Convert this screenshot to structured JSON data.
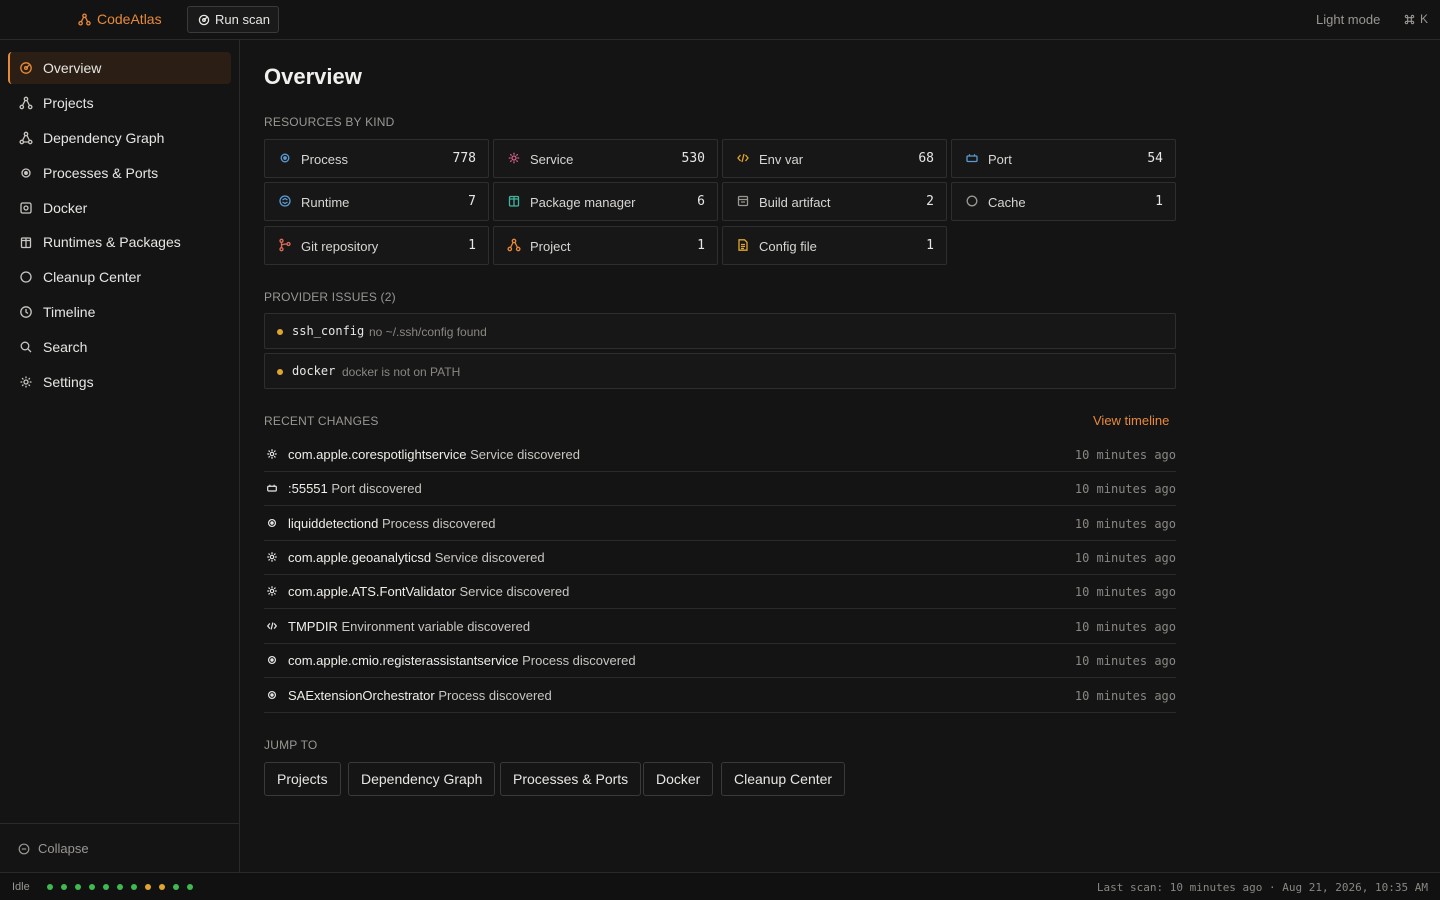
{
  "app": {
    "name": "CodeAtlas",
    "run_scan_label": "Run scan",
    "theme_toggle_label": "Light mode",
    "cmdk_key": "K"
  },
  "sidebar": {
    "items": [
      {
        "label": "Overview",
        "icon": "radar-icon",
        "active": true
      },
      {
        "label": "Projects",
        "icon": "project-icon"
      },
      {
        "label": "Dependency Graph",
        "icon": "graph-icon"
      },
      {
        "label": "Processes & Ports",
        "icon": "process-icon"
      },
      {
        "label": "Docker",
        "icon": "docker-icon"
      },
      {
        "label": "Runtimes & Packages",
        "icon": "package-icon"
      },
      {
        "label": "Cleanup Center",
        "icon": "cleanup-icon"
      },
      {
        "label": "Timeline",
        "icon": "clock-icon"
      },
      {
        "label": "Search",
        "icon": "search-icon"
      },
      {
        "label": "Settings",
        "icon": "gear-icon"
      }
    ],
    "collapse_label": "Collapse"
  },
  "main": {
    "title": "Overview",
    "resources_label": "RESOURCES BY KIND",
    "kinds": [
      {
        "label": "Process",
        "count": "778",
        "icon": "process-icon",
        "color": "#5b9bd5"
      },
      {
        "label": "Service",
        "count": "530",
        "icon": "service-icon",
        "color": "#d9608c"
      },
      {
        "label": "Env var",
        "count": "68",
        "icon": "env-var-icon",
        "color": "#e0a52e"
      },
      {
        "label": "Port",
        "count": "54",
        "icon": "port-icon",
        "color": "#5b9bd5"
      },
      {
        "label": "Runtime",
        "count": "7",
        "icon": "runtime-icon",
        "color": "#5b9bd5"
      },
      {
        "label": "Package manager",
        "count": "6",
        "icon": "package-manager-icon",
        "color": "#3fb5a0"
      },
      {
        "label": "Build artifact",
        "count": "2",
        "icon": "build-artifact-icon",
        "color": "#9a9792"
      },
      {
        "label": "Cache",
        "count": "1",
        "icon": "cache-icon",
        "color": "#9a9792"
      },
      {
        "label": "Git repository",
        "count": "1",
        "icon": "git-icon",
        "color": "#e06a5a"
      },
      {
        "label": "Project",
        "count": "1",
        "icon": "project-icon",
        "color": "#e8893a"
      },
      {
        "label": "Config file",
        "count": "1",
        "icon": "config-file-icon",
        "color": "#e0a52e"
      }
    ],
    "issues_label": "PROVIDER ISSUES (2)",
    "issues": [
      {
        "name": "ssh_config",
        "message": "no ~/.ssh/config found"
      },
      {
        "name": "docker",
        "message": "docker is not on PATH"
      }
    ],
    "changes_label": "RECENT CHANGES",
    "view_timeline_label": "View timeline",
    "changes": [
      {
        "name": "com.apple.corespotlightservice",
        "action": "Service discovered",
        "time": "10 minutes ago",
        "icon": "service-icon"
      },
      {
        "name": ":55551",
        "action": "Port discovered",
        "time": "10 minutes ago",
        "icon": "port-icon"
      },
      {
        "name": "liquiddetectiond",
        "action": "Process discovered",
        "time": "10 minutes ago",
        "icon": "process-icon"
      },
      {
        "name": "com.apple.geoanalyticsd",
        "action": "Service discovered",
        "time": "10 minutes ago",
        "icon": "service-icon"
      },
      {
        "name": "com.apple.ATS.FontValidator",
        "action": "Service discovered",
        "time": "10 minutes ago",
        "icon": "service-icon"
      },
      {
        "name": "TMPDIR",
        "action": "Environment variable discovered",
        "time": "10 minutes ago",
        "icon": "env-var-icon"
      },
      {
        "name": "com.apple.cmio.registerassistantservice",
        "action": "Process discovered",
        "time": "10 minutes ago",
        "icon": "process-icon"
      },
      {
        "name": "SAExtensionOrchestrator",
        "action": "Process discovered",
        "time": "10 minutes ago",
        "icon": "process-icon"
      }
    ],
    "jump_label": "JUMP TO",
    "jump_links": [
      "Projects",
      "Dependency Graph",
      "Processes & Ports",
      "Docker",
      "Cleanup Center"
    ]
  },
  "status": {
    "state": "Idle",
    "dot_colors": [
      "#3fb950",
      "#3fb950",
      "#3fb950",
      "#3fb950",
      "#3fb950",
      "#3fb950",
      "#3fb950",
      "#e0a52e",
      "#e0a52e",
      "#3fb950",
      "#3fb950"
    ],
    "last_scan": "Last scan: 10 minutes ago · Aug 21, 2026, 10:35 AM"
  }
}
